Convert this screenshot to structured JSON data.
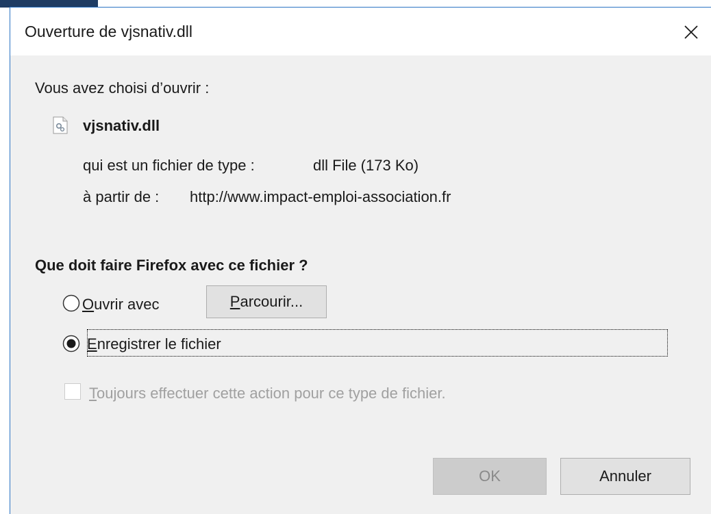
{
  "dialog": {
    "title": "Ouverture de vjsnativ.dll"
  },
  "intro": "Vous avez choisi d’ouvrir :",
  "file": {
    "name": "vjsnativ.dll",
    "type_label": "qui est un fichier de type :",
    "type_value": "dll File (173 Ko)",
    "source_label": "à partir de :",
    "source_value": "http://www.impact-emploi-association.fr",
    "icon": "dll-file-icon"
  },
  "question": "Que doit faire Firefox avec ce fichier ?",
  "options": {
    "open_with": {
      "mnemonic": "O",
      "rest": "uvrir avec",
      "selected": false
    },
    "browse_button": {
      "mnemonic": "P",
      "rest": "arcourir..."
    },
    "save_file": {
      "mnemonic": "E",
      "rest": "nregistrer le fichier",
      "selected": true
    },
    "always_do": {
      "mnemonic": "T",
      "rest": "oujours effectuer cette action pour ce type de fichier.",
      "checked": false,
      "enabled": false
    }
  },
  "buttons": {
    "ok": "OK",
    "cancel": "Annuler"
  },
  "colors": {
    "window_border": "#2b73c4",
    "dialog_bg": "#f0f0f0",
    "button_bg": "#e1e1e1",
    "disabled_text": "#a0a0a0"
  }
}
